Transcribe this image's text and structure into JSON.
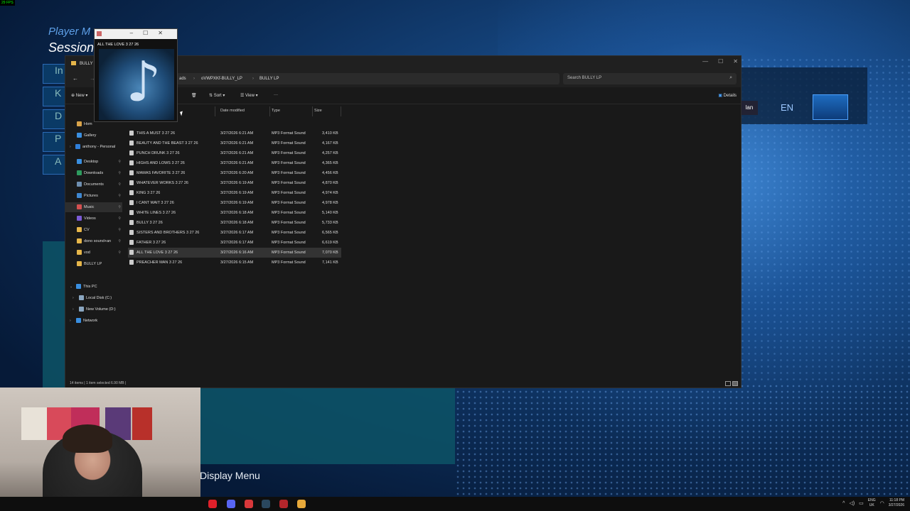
{
  "overlay": {
    "fps": "29 FPS"
  },
  "game": {
    "title": "Player M",
    "subtitle": "Session",
    "menu_items": [
      "In",
      "K",
      "D",
      "P",
      "A"
    ],
    "display_menu": "Display Menu",
    "lang": "EN",
    "lang_tag": "lan"
  },
  "media_popup": {
    "title": "ALL THE LOVE 3 27 26",
    "art_icon": "music-note-icon"
  },
  "explorer": {
    "window_title": "BULLY L",
    "breadcrumbs": [
      "ads",
      "oVWPXKf-BULLY_LP",
      "BULLY LP"
    ],
    "search_placeholder": "Search BULLY LP",
    "toolbar": {
      "new": "New",
      "sort": "Sort",
      "view": "View",
      "more": "···",
      "details": "Details"
    },
    "sidebar": [
      {
        "label": "Hom",
        "icon": "home-icon",
        "color": "#d9a34a",
        "pinned": false,
        "expand": false
      },
      {
        "label": "Gallery",
        "icon": "gallery-icon",
        "color": "#3b8fe0",
        "pinned": false,
        "expand": false
      },
      {
        "label": "anthony - Personal",
        "icon": "cloud-icon",
        "color": "#2f7ed8",
        "pinned": false,
        "expand": true
      },
      {
        "label": "Desktop",
        "icon": "desktop-icon",
        "color": "#3a8fe0",
        "pinned": true,
        "expand": false
      },
      {
        "label": "Downloads",
        "icon": "downloads-icon",
        "color": "#2e9b5e",
        "pinned": true,
        "expand": false
      },
      {
        "label": "Documents",
        "icon": "documents-icon",
        "color": "#6f8fb0",
        "pinned": true,
        "expand": false
      },
      {
        "label": "Pictures",
        "icon": "pictures-icon",
        "color": "#3f87d0",
        "pinned": true,
        "expand": false
      },
      {
        "label": "Music",
        "icon": "music-icon",
        "color": "#d45050",
        "pinned": true,
        "expand": false
      },
      {
        "label": "Videos",
        "icon": "videos-icon",
        "color": "#7b5bd6",
        "pinned": true,
        "expand": false
      },
      {
        "label": "CV",
        "icon": "folder-icon",
        "color": "#e6b64a",
        "pinned": true,
        "expand": false
      },
      {
        "label": "dono sound+an",
        "icon": "folder-icon",
        "color": "#e6b64a",
        "pinned": true,
        "expand": false
      },
      {
        "label": "vod",
        "icon": "folder-icon",
        "color": "#e6b64a",
        "pinned": true,
        "expand": false
      },
      {
        "label": "BULLY LP",
        "icon": "folder-icon",
        "color": "#e6b64a",
        "pinned": false,
        "expand": false
      }
    ],
    "tree": [
      {
        "label": "This PC",
        "icon": "pc-icon",
        "color": "#3a8fe0",
        "expanded": true
      },
      {
        "label": "Local Disk (C:)",
        "icon": "disk-icon",
        "color": "#8aa6c0",
        "expanded": false
      },
      {
        "label": "New Volume (D:)",
        "icon": "disk-icon",
        "color": "#8aa6c0",
        "expanded": false
      },
      {
        "label": "Network",
        "icon": "network-icon",
        "color": "#3a8fe0",
        "expanded": false
      }
    ],
    "columns": [
      "Date modified",
      "Type",
      "Size"
    ],
    "files": [
      {
        "name": "THIS A MUST 3 27 26",
        "date": "3/27/2026 6:21 AM",
        "type": "MP3 Format Sound",
        "size": "3,410 KB"
      },
      {
        "name": "BEAUTY AND THE BEAST 3 27 26",
        "date": "3/27/2026 6:21 AM",
        "type": "MP3 Format Sound",
        "size": "4,167 KB"
      },
      {
        "name": "PUNCH DRUNK 3 27 26",
        "date": "3/27/2026 6:21 AM",
        "type": "MP3 Format Sound",
        "size": "4,257 KB"
      },
      {
        "name": "HIGHS AND LOWS 3 27 26",
        "date": "3/27/2026 6:21 AM",
        "type": "MP3 Format Sound",
        "size": "4,365 KB"
      },
      {
        "name": "MAMAS FAVORITE 3 27 26",
        "date": "3/27/2026 6:20 AM",
        "type": "MP3 Format Sound",
        "size": "4,456 KB"
      },
      {
        "name": "WHATEVER WORKS 3 27 26",
        "date": "3/27/2026 6:19 AM",
        "type": "MP3 Format Sound",
        "size": "4,870 KB"
      },
      {
        "name": "KING 3 27 26",
        "date": "3/27/2026 6:19 AM",
        "type": "MP3 Format Sound",
        "size": "4,974 KB"
      },
      {
        "name": "I CANT WAIT 3 27 26",
        "date": "3/27/2026 6:19 AM",
        "type": "MP3 Format Sound",
        "size": "4,978 KB"
      },
      {
        "name": "WHITE LINES 3 27 26",
        "date": "3/27/2026 6:18 AM",
        "type": "MP3 Format Sound",
        "size": "5,140 KB"
      },
      {
        "name": "BULLY 3 27 26",
        "date": "3/27/2026 6:18 AM",
        "type": "MP3 Format Sound",
        "size": "5,733 KB"
      },
      {
        "name": "SISTERS AND BROTHERS 3 27 26",
        "date": "3/27/2026 6:17 AM",
        "type": "MP3 Format Sound",
        "size": "6,565 KB"
      },
      {
        "name": "FATHER 3 27 26",
        "date": "3/27/2026 6:17 AM",
        "type": "MP3 Format Sound",
        "size": "6,619 KB"
      },
      {
        "name": "ALL THE LOVE 3 27 26",
        "date": "3/27/2026 6:16 AM",
        "type": "MP3 Format Sound",
        "size": "7,070 KB",
        "selected": true
      },
      {
        "name": "PREACHER MAN 3 27 26",
        "date": "3/27/2026 6:15 AM",
        "type": "MP3 Format Sound",
        "size": "7,141 KB"
      }
    ],
    "status": "14 items  |  1 item selected  6.90 MB  |"
  },
  "taskbar": {
    "icons": [
      {
        "name": "opera-gx-icon",
        "color": "#e0202a"
      },
      {
        "name": "discord-icon",
        "color": "#5865f2"
      },
      {
        "name": "record-icon",
        "color": "#d9383a"
      },
      {
        "name": "steam-icon",
        "color": "#2a475e"
      },
      {
        "name": "game-icon",
        "color": "#b3262b"
      },
      {
        "name": "media-player-icon",
        "color": "#e8a93a"
      }
    ],
    "lang_top": "ENG",
    "lang_bottom": "UK",
    "time": "11:18 PM",
    "date": "3/27/2026"
  }
}
